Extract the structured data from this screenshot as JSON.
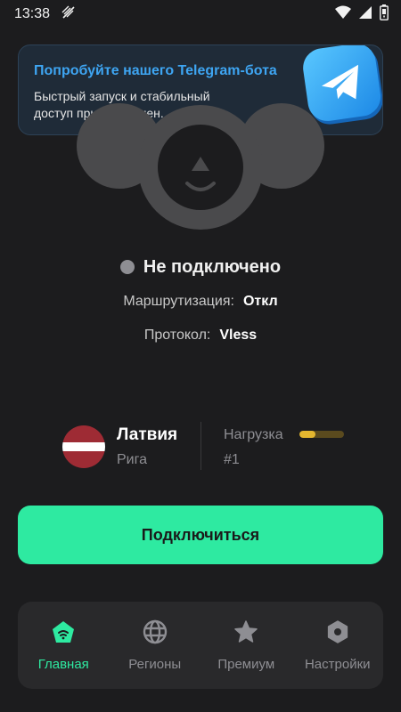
{
  "status_bar": {
    "time": "13:38",
    "icons": [
      "no-sim-icon",
      "wifi-icon",
      "signal-icon",
      "battery-icon"
    ]
  },
  "banner": {
    "title": "Попробуйте нашего Telegram-бота",
    "text": "Быстрый запуск и стабильный доступ при ограничен...",
    "icon": "telegram-icon"
  },
  "connection": {
    "status": "Не подключено",
    "status_color": "#8e8e93",
    "routing_label": "Маршрутизация:",
    "routing_value": "Откл",
    "protocol_label": "Протокол:",
    "protocol_value": "Vless"
  },
  "server": {
    "country": "Латвия",
    "city": "Рига",
    "load_label": "Нагрузка",
    "load_fraction": 0.35,
    "number": "#1"
  },
  "connect_button": {
    "label": "Подключиться",
    "color": "#2eeaa1"
  },
  "nav": [
    {
      "label": "Главная",
      "icon": "home-icon",
      "active": true
    },
    {
      "label": "Регионы",
      "icon": "globe-icon",
      "active": false
    },
    {
      "label": "Премиум",
      "icon": "star-icon",
      "active": false
    },
    {
      "label": "Настройки",
      "icon": "settings-icon",
      "active": false
    }
  ]
}
